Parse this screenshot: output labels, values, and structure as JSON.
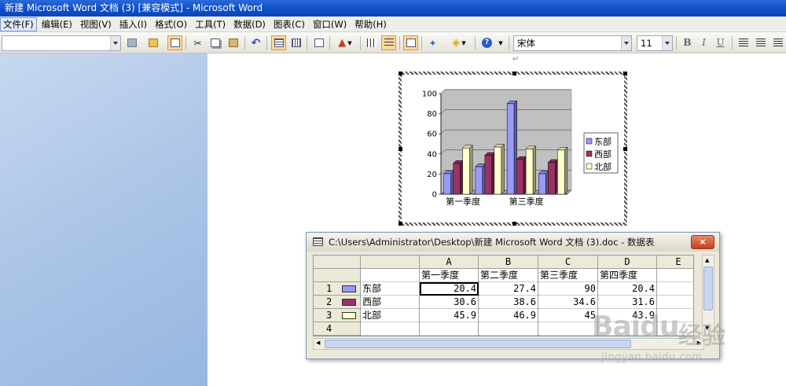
{
  "window": {
    "title": "新建 Microsoft Word 文档 (3) [兼容模式] - Microsoft Word"
  },
  "menu": {
    "items": [
      "文件(F)",
      "编辑(E)",
      "视图(V)",
      "插入(I)",
      "格式(O)",
      "工具(T)",
      "数据(D)",
      "图表(C)",
      "窗口(W)",
      "帮助(H)"
    ]
  },
  "toolbar": {
    "font_name": "宋体",
    "font_size": "11",
    "bold": "B",
    "italic": "I",
    "underline": "U"
  },
  "document": {
    "paragraph_mark": "↵"
  },
  "chart_data": {
    "type": "bar",
    "categories": [
      "第一季度",
      "第二季度",
      "第三季度",
      "第四季度"
    ],
    "x_tick_labels_visible": [
      "第一季度",
      "第三季度"
    ],
    "series": [
      {
        "name": "东部",
        "values": [
          20.4,
          27.4,
          90,
          20.4
        ],
        "color": "#9999ff"
      },
      {
        "name": "西部",
        "values": [
          30.6,
          38.6,
          34.6,
          31.6
        ],
        "color": "#993366"
      },
      {
        "name": "北部",
        "values": [
          45.9,
          46.9,
          45,
          43.9
        ],
        "color": "#ffffcc"
      }
    ],
    "ylim": [
      0,
      100
    ],
    "yticks": [
      "100",
      "80",
      "60",
      "40",
      "20",
      "0"
    ],
    "grid": true,
    "legend_position": "right",
    "style": "3d-clustered-column"
  },
  "datasheet": {
    "title": "C:\\Users\\Administrator\\Desktop\\新建 Microsoft Word 文档 (3).doc - 数据表",
    "close": "×",
    "columns": [
      "A",
      "B",
      "C",
      "D",
      "E"
    ],
    "col_headers": [
      "第一季度",
      "第二季度",
      "第三季度",
      "第四季度",
      ""
    ],
    "rows": [
      {
        "num": "1",
        "label": "东部",
        "values": [
          "20.4",
          "27.4",
          "90",
          "20.4"
        ],
        "icon_color": "#9999ff"
      },
      {
        "num": "2",
        "label": "西部",
        "values": [
          "30.6",
          "38.6",
          "34.6",
          "31.6"
        ],
        "icon_color": "#993366"
      },
      {
        "num": "3",
        "label": "北部",
        "values": [
          "45.9",
          "46.9",
          "45",
          "43.9"
        ],
        "icon_color": "#ffffcc"
      },
      {
        "num": "4",
        "label": "",
        "values": [
          "",
          "",
          "",
          ""
        ],
        "icon_color": ""
      }
    ]
  },
  "watermark": {
    "brand": "Baidu",
    "label": "经验",
    "url": "jingyan.baidu.com"
  }
}
